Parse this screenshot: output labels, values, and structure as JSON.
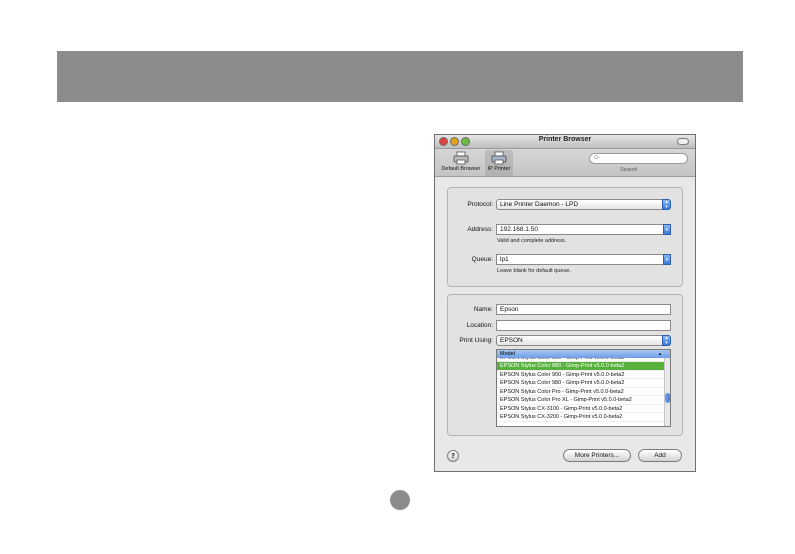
{
  "window": {
    "title": "Printer Browser"
  },
  "toolbar": {
    "default_browser_label": "Default Browser",
    "ip_printer_label": "IP Printer",
    "search_placeholder": "Q-",
    "search_label": "Search"
  },
  "connection": {
    "protocol_label": "Protocol:",
    "protocol_value": "Line Printer Daemon - LPD",
    "address_label": "Address:",
    "address_value": "192.168.1.50",
    "address_hint": "Valid and complete address.",
    "queue_label": "Queue:",
    "queue_value": "lp1",
    "queue_hint": "Leave blank for default queue."
  },
  "details": {
    "name_label": "Name:",
    "name_value": "Epson",
    "location_label": "Location:",
    "location_value": "",
    "print_using_label": "Print Using:",
    "print_using_value": "EPSON"
  },
  "model_list": {
    "header": "Model",
    "cut_row": "EPSON Stylus Color 880 - Gimp-Print v5.0.0-beta2",
    "rows": [
      "EPSON Stylus Color 880 - Gimp-Print v5.0.0-beta2",
      "EPSON Stylus Color 900 - Gimp-Print v5.0.0-beta2",
      "EPSON Stylus Color 980 - Gimp-Print v5.0.0-beta2",
      "EPSON Stylus Color Pro - Gimp-Print v5.0.0-beta2",
      "EPSON Stylus Color Pro XL - Gimp-Print v5.0.0-beta2",
      "EPSON Stylus CX-3100 - Gimp-Print v5.0.0-beta2",
      "EPSON Stylus CX-3200 - Gimp-Print v5.0.0-beta2"
    ],
    "selected_index": 0
  },
  "buttons": {
    "help_label": "?",
    "more_printers_label": "More Printers...",
    "add_label": "Add"
  },
  "colors": {
    "header_band": "#8c8c8c",
    "selection": "#57b13b",
    "accent_blue": "#3a78d8"
  }
}
